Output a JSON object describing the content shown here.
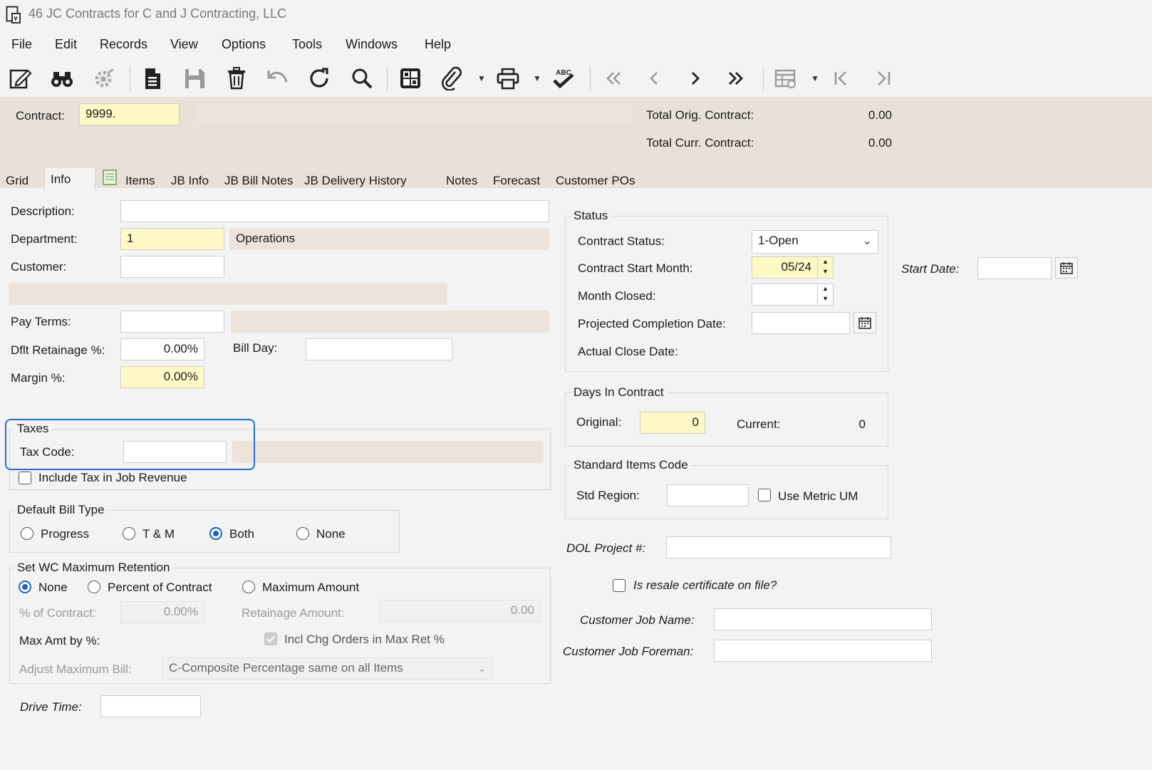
{
  "window": {
    "title": "46 JC Contracts for C and J Contracting, LLC"
  },
  "menu": [
    "File",
    "Edit",
    "Records",
    "View",
    "Options",
    "Tools",
    "Windows",
    "Help"
  ],
  "toolbar": {
    "icons": [
      "edit-icon",
      "binoculars-icon",
      "settings-icon",
      "new-document-icon",
      "save-icon",
      "delete-icon",
      "undo-icon",
      "refresh-icon",
      "search-icon",
      "grid-layout-icon",
      "attachment-icon",
      "print-icon",
      "spellcheck-icon",
      "first-record-icon",
      "previous-record-icon",
      "next-record-icon",
      "last-record-icon",
      "table-settings-icon",
      "jump-first-icon",
      "jump-last-icon"
    ],
    "spellcheck_label": "ABC"
  },
  "header": {
    "contract_label": "Contract:",
    "contract_value": "9999.",
    "total_orig_label": "Total Orig. Contract:",
    "total_orig_value": "0.00",
    "total_curr_label": "Total Curr. Contract:",
    "total_curr_value": "0.00"
  },
  "tabs": [
    {
      "label": "Grid",
      "active": false
    },
    {
      "label": "Info",
      "active": true
    },
    {
      "label": "Items",
      "active": false
    },
    {
      "label": "JB Info",
      "active": false
    },
    {
      "label": "JB Bill Notes",
      "active": false
    },
    {
      "label": "JB Delivery History",
      "active": false
    },
    {
      "label": "Notes",
      "active": false
    },
    {
      "label": "Forecast",
      "active": false
    },
    {
      "label": "Customer POs",
      "active": false
    }
  ],
  "info": {
    "description_label": "Description:",
    "description_value": "",
    "department_label": "Department:",
    "department_value": "1",
    "department_name": "Operations",
    "customer_label": "Customer:",
    "customer_value": "",
    "pay_terms_label": "Pay Terms:",
    "pay_terms_value": "",
    "retainage_label": "Dflt Retainage %:",
    "retainage_value": "0.00%",
    "bill_day_label": "Bill Day:",
    "bill_day_value": "",
    "margin_label": "Margin %:",
    "margin_value": "0.00%"
  },
  "taxes": {
    "title": "Taxes",
    "tax_code_label": "Tax Code:",
    "tax_code_value": "",
    "include_tax_label": "Include Tax in Job Revenue",
    "include_tax_checked": false
  },
  "bill_type": {
    "title": "Default Bill Type",
    "options": [
      "Progress",
      "T & M",
      "Both",
      "None"
    ],
    "selected": "Both"
  },
  "wc_retention": {
    "title": "Set WC Maximum Retention",
    "options": [
      "None",
      "Percent of Contract",
      "Maximum Amount"
    ],
    "selected": "None",
    "pct_label": "% of Contract:",
    "pct_value": "0.00%",
    "retainage_amount_label": "Retainage Amount:",
    "retainage_amount_value": "0.00",
    "max_amt_label": "Max Amt by %:",
    "incl_chg_label": "Incl Chg Orders in Max Ret %",
    "adjust_label": "Adjust Maximum Bill:",
    "adjust_value": "C-Composite Percentage same on all Items"
  },
  "drive_time": {
    "label": "Drive Time:",
    "value": ""
  },
  "status": {
    "title": "Status",
    "contract_status_label": "Contract Status:",
    "contract_status_value": "1-Open",
    "start_month_label": "Contract Start Month:",
    "start_month_value": "05/24",
    "month_closed_label": "Month Closed:",
    "month_closed_value": "",
    "projected_label": "Projected Completion Date:",
    "projected_value": "",
    "actual_close_label": "Actual Close Date:",
    "start_date_label": "Start Date:",
    "start_date_value": ""
  },
  "days": {
    "title": "Days In Contract",
    "original_label": "Original:",
    "original_value": "0",
    "current_label": "Current:",
    "current_value": "0"
  },
  "std_items": {
    "title": "Standard Items Code",
    "region_label": "Std Region:",
    "region_value": "",
    "metric_label": "Use Metric UM"
  },
  "extra": {
    "dol_label": "DOL Project #:",
    "dol_value": "",
    "resale_label": "Is resale certificate on file?",
    "job_name_label": "Customer Job Name:",
    "job_name_value": "",
    "job_foreman_label": "Customer Job Foreman:",
    "job_foreman_value": ""
  }
}
